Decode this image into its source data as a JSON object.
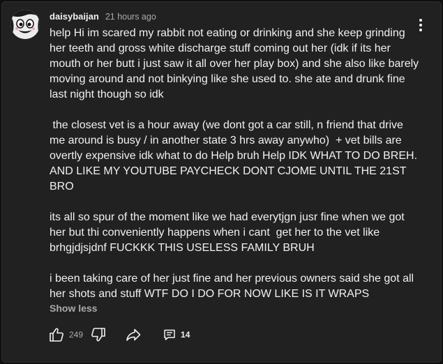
{
  "comment": {
    "author": "daisybaijan",
    "timestamp": "21 hours ago",
    "avatar_icon": "cartoon-face-avatar",
    "paragraphs": [
      "help Hi im scared my rabbit not eating or drinking and she keep grinding her teeth and gross white discharge stuff coming out her (idk if its her mouth or her butt i just saw it all over her play box) and she also like barely moving around and not binkying like she used to. she ate and drunk fine last night though so idk",
      " the closest vet is a hour away (we dont got a car still, n friend that drive me around is busy / in another state 3 hrs away anywho)  + vet bills are overtly expensive idk what to do Help bruh Help IDK WHAT TO DO BREH. AND LIKE MY YOUTUBE PAYCHECK DONT CJOME UNTIL THE 21ST BRO",
      "its all so spur of the moment like we had everytjgn jusr fine when we got her but thi conveniently happens when i cant  get her to the vet like brhgjdjsjdnf FUCKKK THIS USELESS FAMILY BRUH",
      "i been taking care of her just fine and her previous owners said she got all her shots and stuff WTF DO I DO FOR NOW LIKE IS IT WRAPS"
    ],
    "show_less_label": "Show less"
  },
  "actions": {
    "like_count": "249",
    "reply_count": "14"
  },
  "colors": {
    "background": "#0f0f0f",
    "card": "#212121",
    "text": "#f1f1f1",
    "secondary_text": "#aaaaaa"
  }
}
